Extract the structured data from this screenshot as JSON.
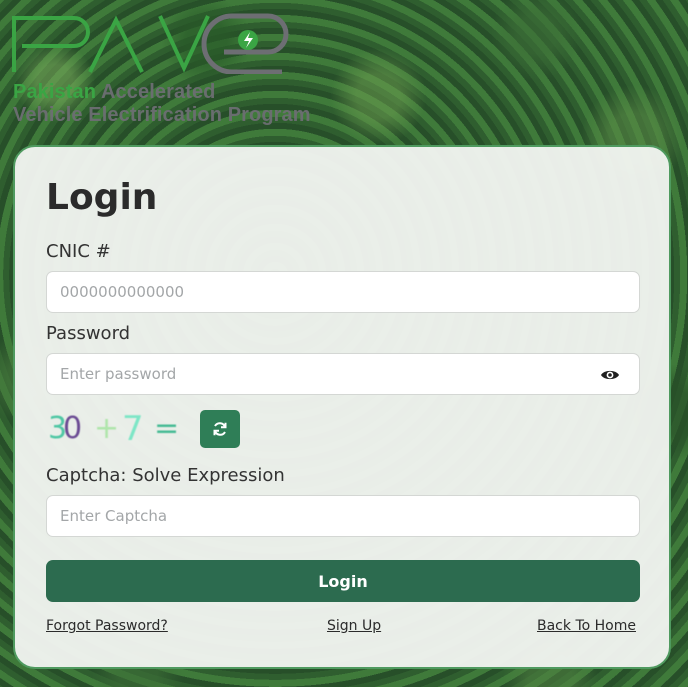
{
  "brand": {
    "logo_text": "PAVE",
    "tagline_line1_highlight": "Pakistan",
    "tagline_line1_rest": " Accelerated",
    "tagline_line2": "Vehicle Electrification Program",
    "colors": {
      "green": "#3aa544",
      "grey": "#6d6e73"
    }
  },
  "login_form": {
    "title": "Login",
    "cnic": {
      "label": "CNIC #",
      "placeholder": "0000000000000",
      "value": ""
    },
    "password": {
      "label": "Password",
      "placeholder": "Enter password",
      "value": "",
      "toggle_icon": "eye-icon"
    },
    "captcha": {
      "digit1": "3",
      "digit2": "0",
      "operator": "+",
      "digit3": "7",
      "equals": "=",
      "refresh_icon": "refresh-icon"
    },
    "captcha_input": {
      "label": "Captcha: Solve Expression",
      "placeholder": "Enter Captcha",
      "value": ""
    },
    "submit_label": "Login",
    "links": {
      "forgot_password": "Forgot Password?",
      "sign_up": "Sign Up",
      "back_home": "Back To Home"
    },
    "colors": {
      "button": "#2c6b4f",
      "refresh": "#2f7e57",
      "card_border": "#4f9a5f"
    }
  }
}
